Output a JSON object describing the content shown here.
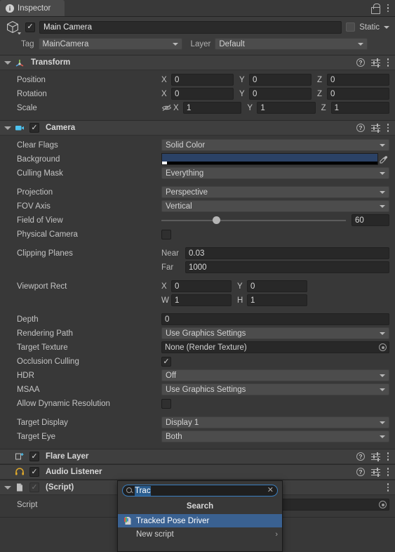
{
  "window": {
    "tab_label": "Inspector",
    "tab_icon": "info-icon",
    "lock_icon": "lock-icon",
    "menu_icon": "kebab-menu-icon"
  },
  "gameobject": {
    "icon": "cube-icon",
    "enabled_check": "✓",
    "name": "Main Camera",
    "static_label": "Static",
    "tag_label": "Tag",
    "tag_value": "MainCamera",
    "layer_label": "Layer",
    "layer_value": "Default"
  },
  "transform": {
    "title": "Transform",
    "icon": "transform-gizmo-icon",
    "rows": [
      {
        "label": "Position",
        "x": "0",
        "y": "0",
        "z": "0"
      },
      {
        "label": "Rotation",
        "x": "0",
        "y": "0",
        "z": "0"
      },
      {
        "label": "Scale",
        "x": "1",
        "y": "1",
        "z": "1"
      }
    ],
    "axis_x": "X",
    "axis_y": "Y",
    "axis_z": "Z"
  },
  "camera": {
    "title": "Camera",
    "icon": "camera-icon",
    "enabled_check": "✓",
    "clear_flags_label": "Clear Flags",
    "clear_flags_value": "Solid Color",
    "background_label": "Background",
    "background_color": "#2b4266",
    "culling_mask_label": "Culling Mask",
    "culling_mask_value": "Everything",
    "projection_label": "Projection",
    "projection_value": "Perspective",
    "fov_axis_label": "FOV Axis",
    "fov_axis_value": "Vertical",
    "field_of_view_label": "Field of View",
    "field_of_view_value": "60",
    "field_of_view_percent": 30,
    "physical_camera_label": "Physical Camera",
    "physical_camera_checked": false,
    "clipping_planes_label": "Clipping Planes",
    "near_label": "Near",
    "near_value": "0.03",
    "far_label": "Far",
    "far_value": "1000",
    "viewport_rect_label": "Viewport Rect",
    "viewport_x_label": "X",
    "viewport_x": "0",
    "viewport_y_label": "Y",
    "viewport_y": "0",
    "viewport_w_label": "W",
    "viewport_w": "1",
    "viewport_h_label": "H",
    "viewport_h": "1",
    "depth_label": "Depth",
    "depth_value": "0",
    "rendering_path_label": "Rendering Path",
    "rendering_path_value": "Use Graphics Settings",
    "target_texture_label": "Target Texture",
    "target_texture_value": "None (Render Texture)",
    "occlusion_culling_label": "Occlusion Culling",
    "occlusion_culling_check": "✓",
    "hdr_label": "HDR",
    "hdr_value": "Off",
    "msaa_label": "MSAA",
    "msaa_value": "Use Graphics Settings",
    "allow_dynamic_resolution_label": "Allow Dynamic Resolution",
    "allow_dynamic_resolution_checked": false,
    "target_display_label": "Target Display",
    "target_display_value": "Display 1",
    "target_eye_label": "Target Eye",
    "target_eye_value": "Both"
  },
  "flare_layer": {
    "title": "Flare Layer",
    "icon": "flare-layer-icon",
    "enabled_check": "✓"
  },
  "audio_listener": {
    "title": "Audio Listener",
    "icon": "headphones-icon",
    "enabled_check": "✓"
  },
  "script_component": {
    "title": "(Script)",
    "icon": "script-file-icon",
    "enabled_check": "✓",
    "script_label": "Script",
    "script_value": ""
  },
  "script_popup": {
    "search_value": "Trac",
    "search_icon": "magnifier-icon",
    "clear_icon": "close-icon",
    "header": "Search",
    "items": [
      {
        "label": "Tracked Pose Driver",
        "selected": true,
        "has_submenu": false,
        "icon": "script-asset-icon"
      },
      {
        "label": "New script",
        "selected": false,
        "has_submenu": true,
        "chevron": "›"
      }
    ]
  },
  "colors": {
    "panel_bg": "#383838",
    "header_bg": "#3f3f3f",
    "field_bg": "#282828",
    "dropdown_bg": "#4c4c4c",
    "accent_blue": "#3a6191",
    "text": "#c4c4c4"
  }
}
